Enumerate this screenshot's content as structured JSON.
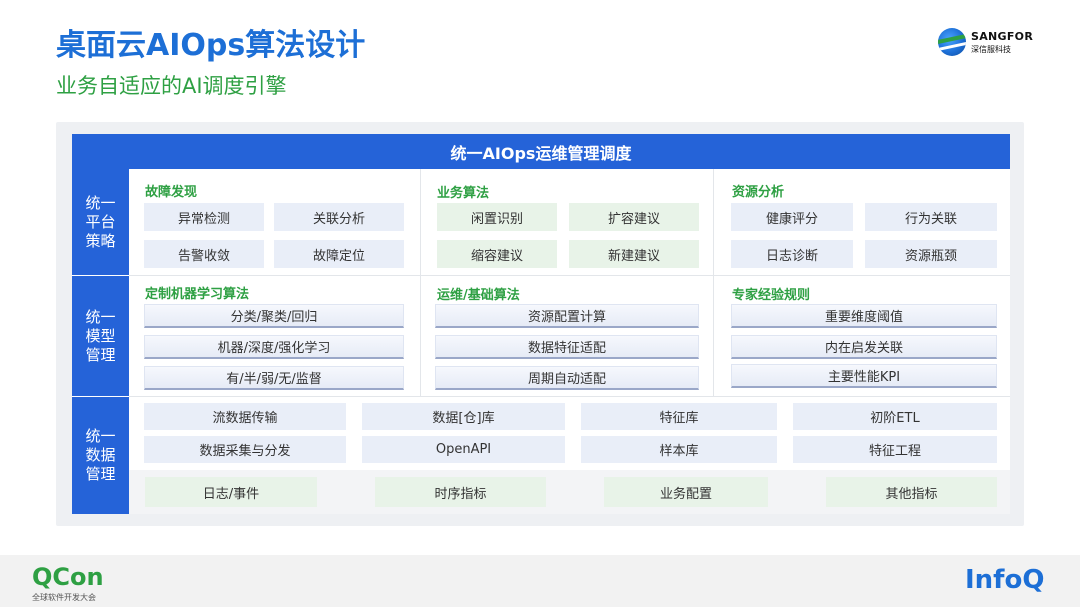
{
  "slide": {
    "title": "桌面云AIOps算法设计",
    "subtitle": "业务自适应的AI调度引擎"
  },
  "brand": {
    "sangfor_name": "SANGFOR",
    "sangfor_cn": "深信服科技",
    "qcon_name": "QCon",
    "qcon_sub": "全球软件开发大会",
    "infoq_name": "InfoQ"
  },
  "diagram": {
    "header": "统一AIOps运维管理调度",
    "rows": [
      {
        "label": "统一平台策略"
      },
      {
        "label": "统一模型管理"
      },
      {
        "label": "统一数据管理"
      }
    ],
    "platform_sections": [
      {
        "title": "故障发现",
        "items": [
          "异常检测",
          "关联分析",
          "告警收敛",
          "故障定位"
        ]
      },
      {
        "title": "业务算法",
        "items": [
          "闲置识别",
          "扩容建议",
          "缩容建议",
          "新建建议"
        ]
      },
      {
        "title": "资源分析",
        "items": [
          "健康评分",
          "行为关联",
          "日志诊断",
          "资源瓶颈"
        ]
      }
    ],
    "model_sections": [
      {
        "title": "定制机器学习算法",
        "items": [
          "分类/聚类/回归",
          "机器/深度/强化学习",
          "有/半/弱/无/监督"
        ]
      },
      {
        "title": "运维/基础算法",
        "items": [
          "资源配置计算",
          "数据特征适配",
          "周期自动适配"
        ]
      },
      {
        "title": "专家经验规则",
        "items": [
          "重要维度阈值",
          "内在启发关联",
          "主要性能KPI"
        ]
      }
    ],
    "data_items_row1": [
      "流数据传输",
      "数据[仓]库",
      "特征库",
      "初阶ETL"
    ],
    "data_items_row2": [
      "数据采集与分发",
      "OpenAPI",
      "样本库",
      "特征工程"
    ],
    "data_sources": [
      "日志/事件",
      "时序指标",
      "业务配置",
      "其他指标"
    ]
  },
  "colors": {
    "primary_blue": "#2563d8",
    "accent_green": "#2ea043"
  }
}
